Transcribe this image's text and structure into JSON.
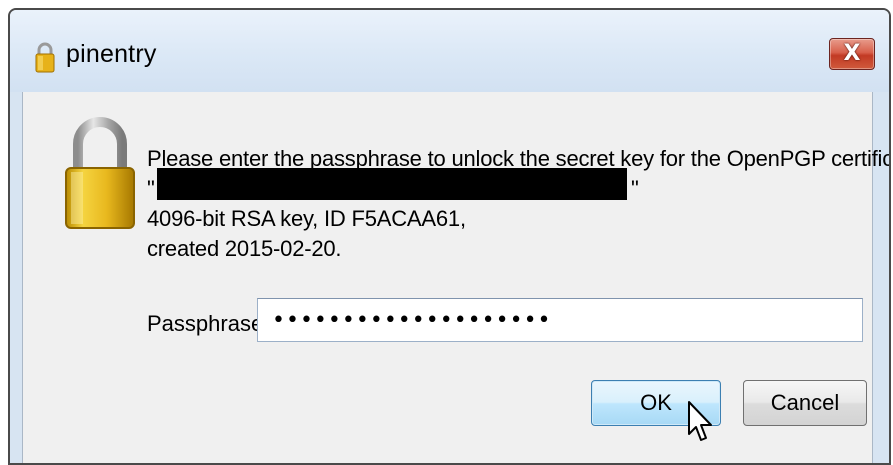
{
  "window": {
    "title": "pinentry",
    "close_symbol": "X",
    "title_icon": "padlock-icon"
  },
  "dialog": {
    "lock_icon": "padlock-icon",
    "message_lines": [
      "Please enter the passphrase to unlock the secret key for the OpenPGP certificate:",
      "\"",
      "4096-bit RSA key, ID F5ACAA61,",
      "created 2015-02-20."
    ],
    "quote_close": "\"",
    "passphrase_label": "Passphrase",
    "passphrase_value": "••••••••••••••••••••",
    "ok_label": "OK",
    "cancel_label": "Cancel"
  },
  "colors": {
    "client_bg": "#f0f0f0",
    "titlebar_bg": "#dbe8f6",
    "close_button": "#c23a24",
    "default_button_border": "#3c7fb1",
    "lock_gold": "#e8b81e"
  }
}
